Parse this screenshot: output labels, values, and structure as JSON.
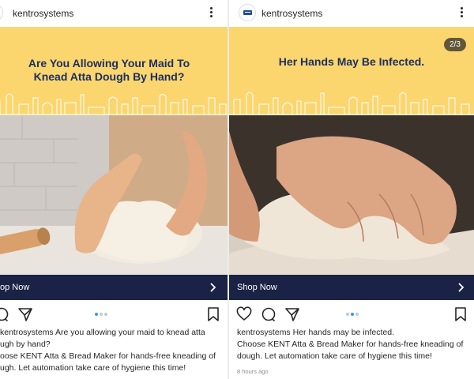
{
  "colors": {
    "banner": "#fbd66e",
    "headline": "#1c2f60",
    "shop_bar": "#1a2345",
    "dot_active": "#3897f0",
    "dot_inactive": "#c7c7c7"
  },
  "posts": [
    {
      "username": "kentrosystems",
      "headline_line1": "Are You Allowing Your Maid To",
      "headline_line2": "Knead Atta Dough By Hand?",
      "shop_label": "op Now",
      "caption_user": "kentrosystems",
      "caption_text": " Are you allowing your maid to knead atta",
      "caption_line2": "ugh by hand?",
      "body_line1": "oose KENT Atta & Bread Maker for hands-free kneading of",
      "body_line2": "ugh. Let automation take care of hygiene this time!",
      "icons": [
        "heart-icon",
        "comment-icon",
        "share-icon",
        "bookmark-icon"
      ]
    },
    {
      "username": "kentrosystems",
      "headline": "Her Hands May Be Infected.",
      "counter": "2/3",
      "shop_label": "Shop Now",
      "caption_user": "kentrosystems",
      "caption_text": " Her hands may be infected.",
      "body_line1": "Choose KENT Atta & Bread Maker for hands-free kneading of",
      "body_line2": "dough. Let automation take care of hygiene this time!",
      "timestamp": "8 hours ago",
      "icons": [
        "heart-icon",
        "comment-icon",
        "share-icon",
        "bookmark-icon"
      ]
    }
  ]
}
